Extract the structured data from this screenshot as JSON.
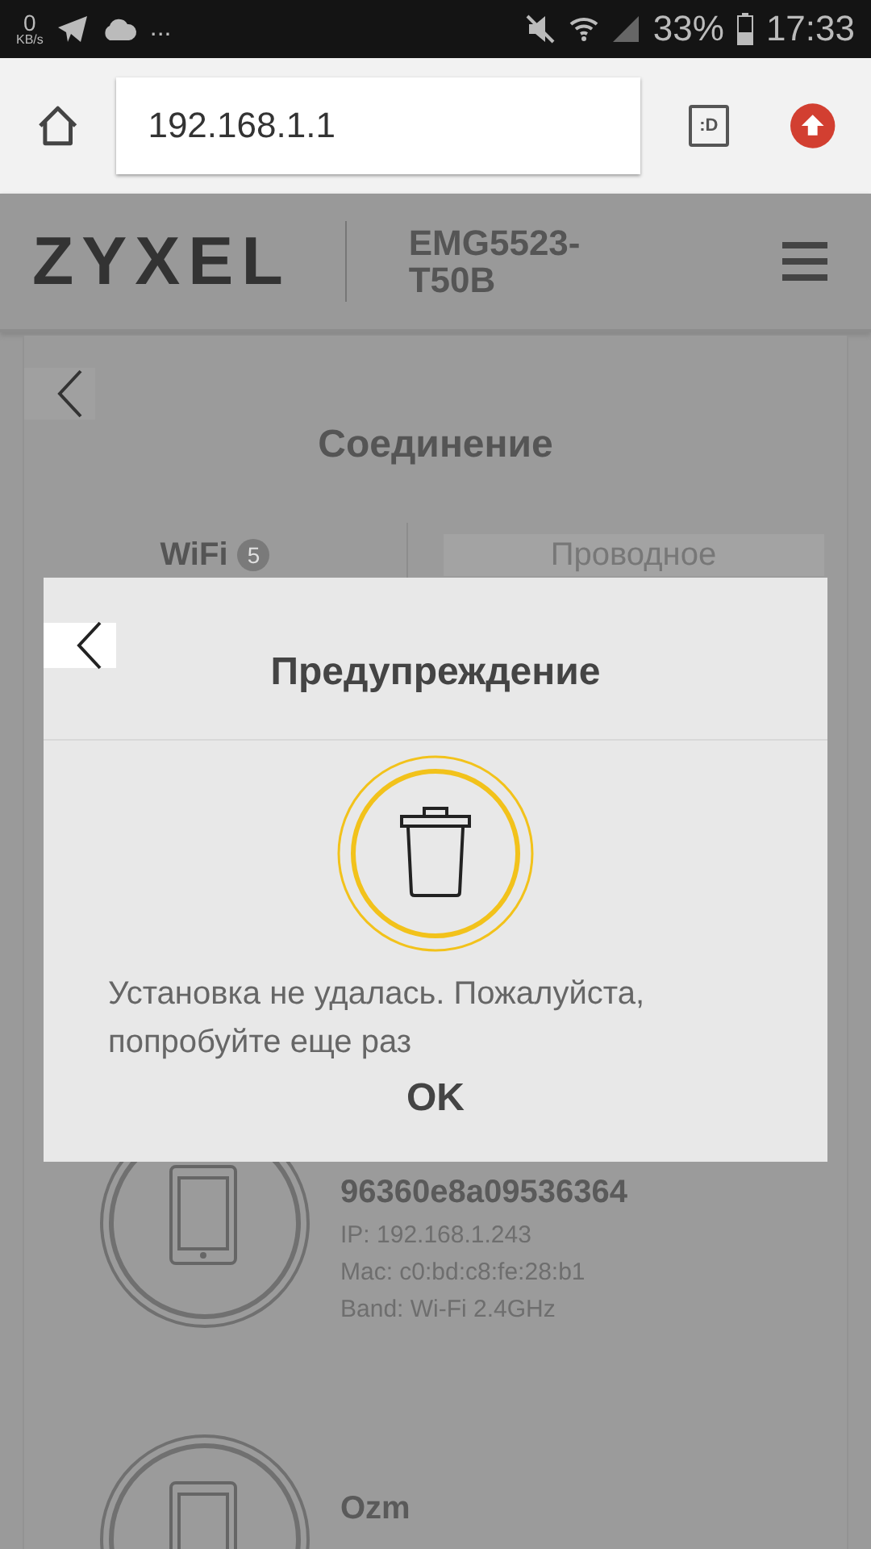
{
  "status_bar": {
    "speed_value": "0",
    "speed_unit": "KB/s",
    "more": "...",
    "battery": "33%",
    "time": "17:33"
  },
  "browser": {
    "url": "192.168.1.1",
    "tabs_button": ":D"
  },
  "header": {
    "logo": "ZYXEL",
    "model": "EMG5523-T50B"
  },
  "page": {
    "title": "Соединение",
    "tabs": [
      {
        "label": "WiFi",
        "count": "5",
        "selected": true
      },
      {
        "label": "Проводное",
        "selected": false
      }
    ],
    "devices": [
      {
        "name": "96360e8a09536364",
        "ip": "IP: 192.168.1.243",
        "mac": "Mac: c0:bd:c8:fe:28:b1",
        "band": "Band: Wi-Fi 2.4GHz"
      },
      {
        "name": "Ozm"
      }
    ]
  },
  "dialog": {
    "title": "Предупреждение",
    "message": "Установка не удалась. Пожалуйста, попробуйте еще раз",
    "button": "OK"
  }
}
